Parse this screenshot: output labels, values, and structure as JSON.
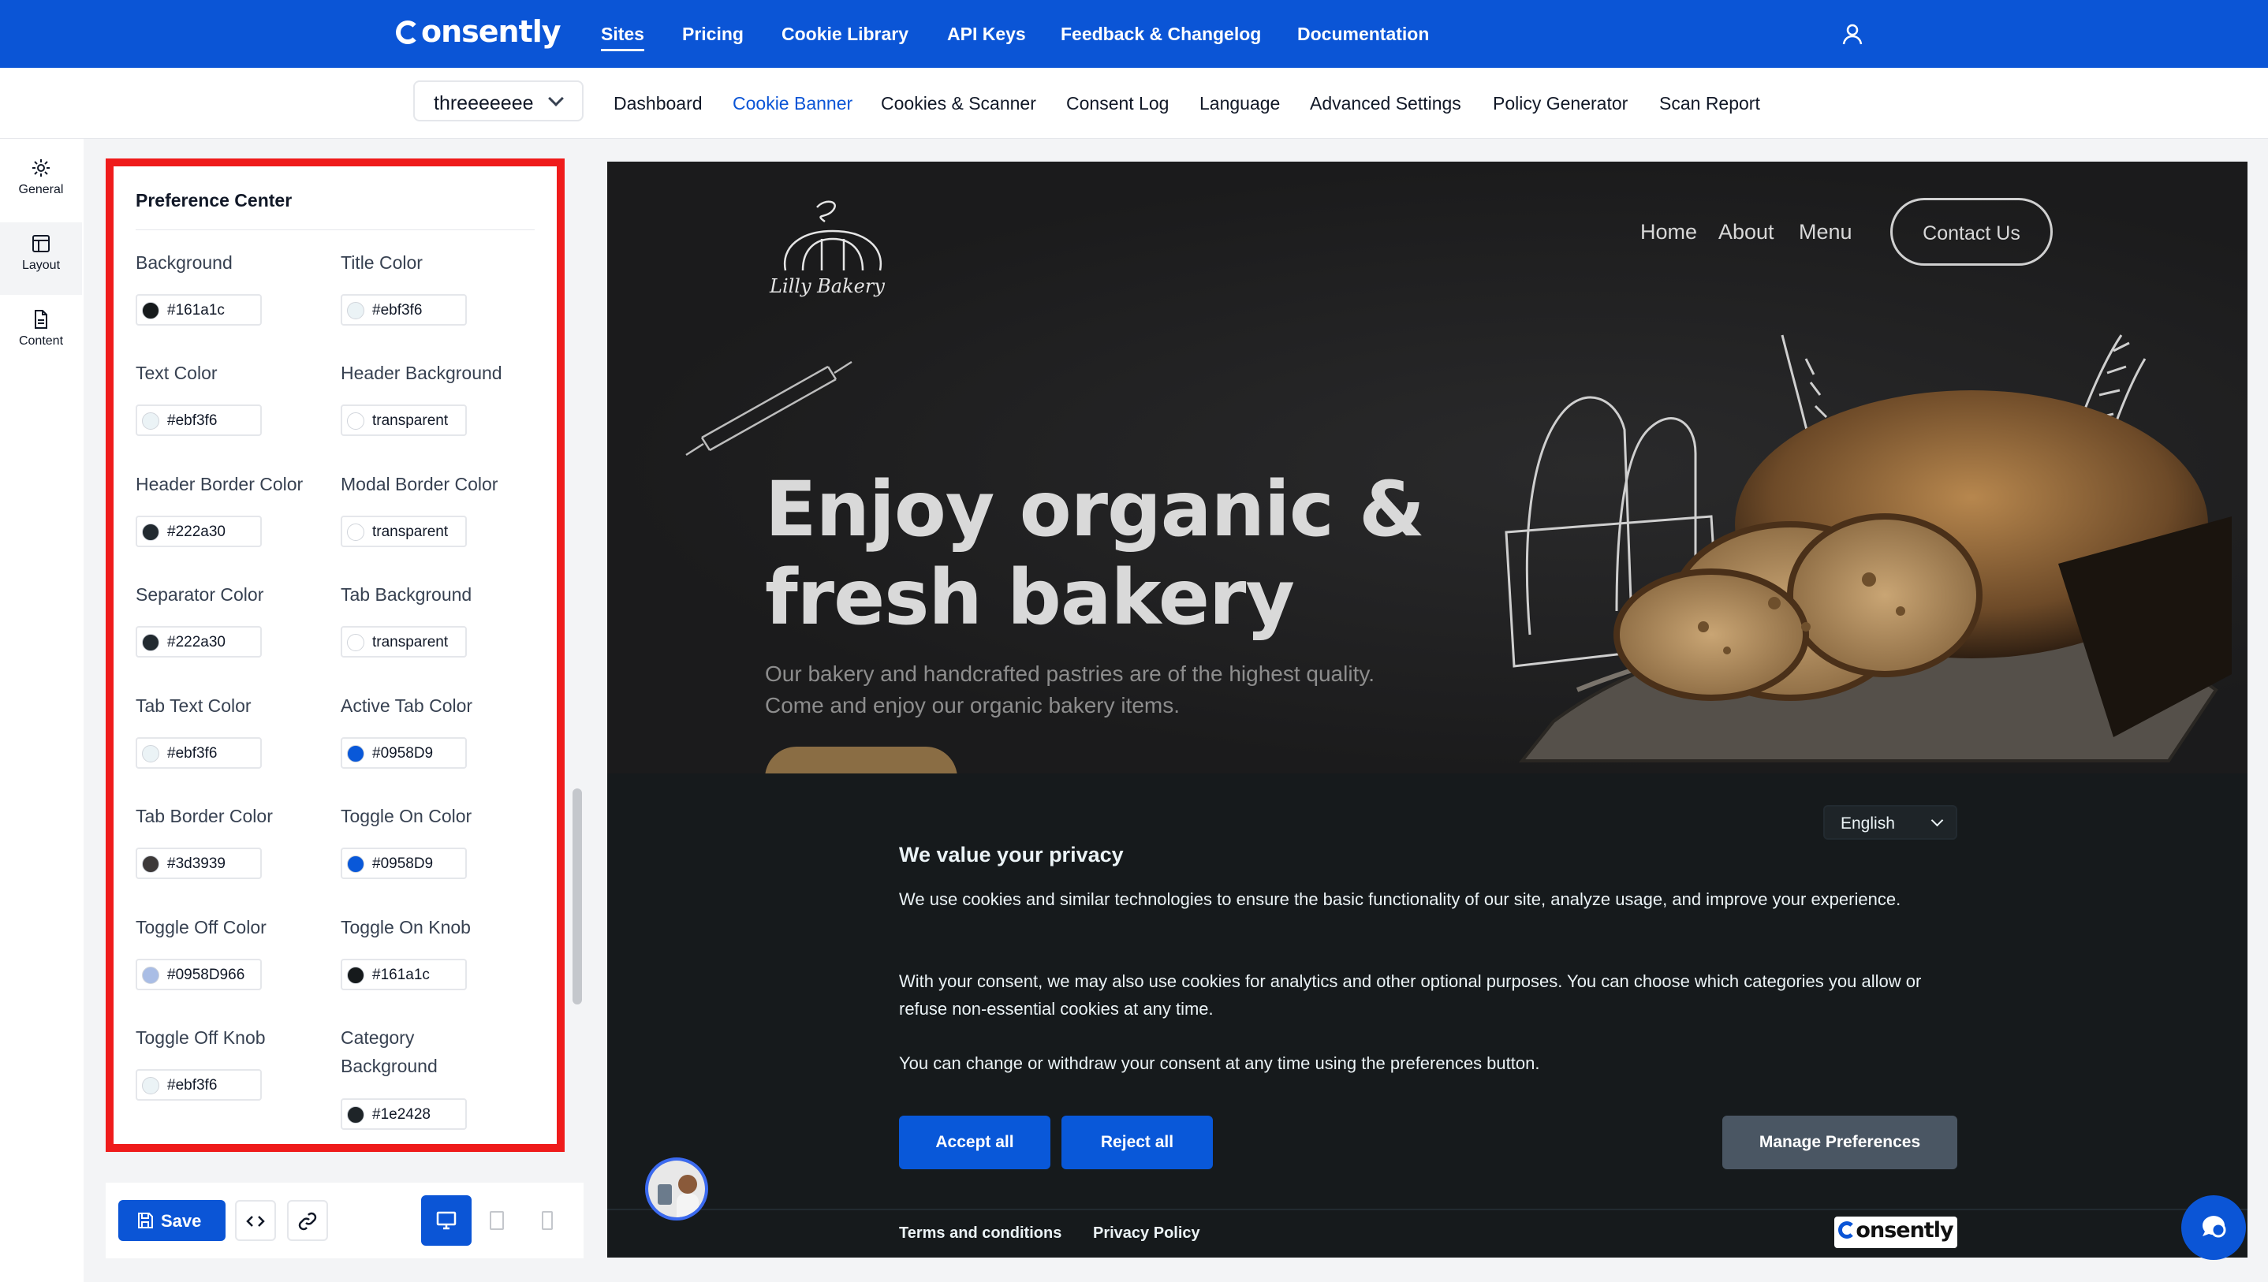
{
  "nav": {
    "brand": "onsently",
    "items": [
      "Sites",
      "Pricing",
      "Cookie Library",
      "API Keys",
      "Feedback & Changelog",
      "Documentation"
    ],
    "active": "Sites",
    "user_icon": "user-icon"
  },
  "subnav": {
    "site_name": "threeeeeee",
    "items": [
      "Dashboard",
      "Cookie Banner",
      "Cookies & Scanner",
      "Consent Log",
      "Language",
      "Advanced Settings",
      "Policy Generator",
      "Scan Report"
    ],
    "active": "Cookie Banner"
  },
  "rail": {
    "items": [
      {
        "label": "General",
        "icon": "gear-icon"
      },
      {
        "label": "Layout",
        "icon": "layout-icon"
      },
      {
        "label": "Content",
        "icon": "document-icon"
      }
    ],
    "active": "Layout"
  },
  "panel": {
    "title": "Preference Center",
    "fields": [
      {
        "label": "Background",
        "value": "#161a1c",
        "swatch": "#161a1c"
      },
      {
        "label": "Title Color",
        "value": "#ebf3f6",
        "swatch": "#ebf3f6"
      },
      {
        "label": "Text Color",
        "value": "#ebf3f6",
        "swatch": "#ebf3f6"
      },
      {
        "label": "Header Background",
        "value": "transparent",
        "swatch": "transparent"
      },
      {
        "label": "Header Border Color",
        "value": "#222a30",
        "swatch": "#222a30"
      },
      {
        "label": "Modal Border Color",
        "value": "transparent",
        "swatch": "transparent"
      },
      {
        "label": "Separator Color",
        "value": "#222a30",
        "swatch": "#222a30"
      },
      {
        "label": "Tab Background",
        "value": "transparent",
        "swatch": "transparent"
      },
      {
        "label": "Tab Text Color",
        "value": "#ebf3f6",
        "swatch": "#ebf3f6"
      },
      {
        "label": "Active Tab Color",
        "value": "#0958D9",
        "swatch": "#0958D9"
      },
      {
        "label": "Tab Border Color",
        "value": "#3d3939",
        "swatch": "#3d3939"
      },
      {
        "label": "Toggle On Color",
        "value": "#0958D9",
        "swatch": "#0958D9"
      },
      {
        "label": "Toggle Off Color",
        "value": "#0958D966",
        "swatch": "#0958D966"
      },
      {
        "label": "Toggle On Knob",
        "value": "#161a1c",
        "swatch": "#161a1c"
      },
      {
        "label": "Toggle Off Knob",
        "value": "#ebf3f6",
        "swatch": "#ebf3f6"
      },
      {
        "label": "Category Background",
        "value": "#1e2428",
        "swatch": "#1e2428"
      }
    ]
  },
  "toolbar": {
    "save_label": "Save",
    "devices": [
      "desktop",
      "tablet",
      "mobile"
    ],
    "active_device": "desktop"
  },
  "preview": {
    "site": {
      "brand": "Lilly Bakery",
      "links": [
        "Home",
        "About",
        "Menu"
      ],
      "contact": "Contact Us",
      "hero_title": "Enjoy organic &\nfresh bakery",
      "hero_text": "Our bakery and handcrafted pastries are of the highest quality. Come and enjoy our organic bakery items."
    },
    "banner": {
      "language": "English",
      "title": "We value your privacy",
      "paragraphs": [
        "We use cookies and similar technologies to ensure the basic functionality of our site, analyze usage, and improve your experience.",
        "With your consent, we may also use cookies for analytics and other optional purposes. You can choose which categories you allow or refuse non-essential cookies at any time.",
        "You can change or withdraw your consent at any time using the preferences button."
      ],
      "accept": "Accept all",
      "reject": "Reject all",
      "manage": "Manage Preferences",
      "terms": "Terms and conditions",
      "privacy": "Privacy Policy",
      "badge": "onsently"
    }
  }
}
